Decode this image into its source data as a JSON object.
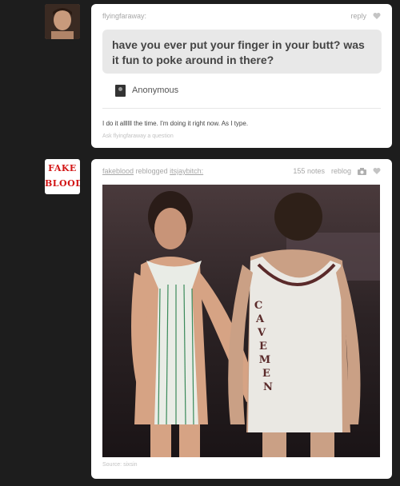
{
  "post1": {
    "username": "flyingfaraway:",
    "reply_label": "reply",
    "question": "have you ever put your finger in your butt? was it fun to poke around in there?",
    "asker": "Anonymous",
    "answer": "I do it allllll the time. I'm doing it right now. As I type.",
    "source_line": "Ask flyingfaraway a question"
  },
  "post2": {
    "avatar_text_line1": "FAKE",
    "avatar_text_line2": "BLOOD",
    "reblogger": "fakeblood",
    "reblogged_word": "reblogged",
    "source_user": "itsjaybitch:",
    "notes": "155 notes",
    "reblog_label": "reblog",
    "photo_jersey_text": [
      "C",
      "A",
      "V",
      "E",
      "M",
      "E",
      "N"
    ],
    "caption": "Source: sixsin"
  },
  "colors": {
    "page_bg": "#1d1d1d",
    "card_bg": "#ffffff",
    "question_bg": "#e8e8e8",
    "logo_red": "#d21414"
  },
  "icons": [
    "heart-icon",
    "camera-icon"
  ]
}
